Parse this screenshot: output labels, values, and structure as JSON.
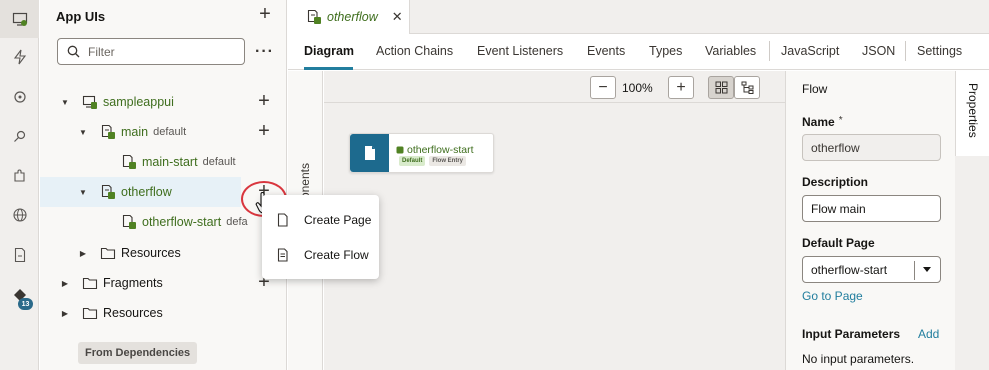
{
  "activity_bar": {
    "items": [
      {
        "icon": "app-uis-icon",
        "active": true
      },
      {
        "icon": "lightning-icon"
      },
      {
        "icon": "service-icon"
      },
      {
        "icon": "plug-icon"
      },
      {
        "icon": "puzzle-icon"
      },
      {
        "icon": "globe-icon"
      },
      {
        "icon": "document-icon"
      },
      {
        "icon": "git-icon",
        "badge": "13"
      }
    ]
  },
  "navigator": {
    "title": "App UIs",
    "filter_placeholder": "Filter",
    "tree": {
      "app": "sampleappui",
      "main": {
        "label": "main",
        "sub": "default"
      },
      "main_start": {
        "label": "main-start",
        "sub": "default"
      },
      "otherflow": {
        "label": "otherflow"
      },
      "otherflow_start": {
        "label": "otherflow-start",
        "sub": "defa"
      },
      "resources_inner": "Resources",
      "fragments": "Fragments",
      "resources": "Resources"
    },
    "from_dependencies": "From Dependencies"
  },
  "popup_menu": {
    "items": [
      "Create Page",
      "Create Flow"
    ]
  },
  "editor": {
    "tab_title": "otherflow",
    "subtabs": [
      "Diagram",
      "Action Chains",
      "Event Listeners",
      "Events",
      "Types",
      "Variables",
      "JavaScript",
      "JSON",
      "Settings"
    ],
    "active_subtab": "Diagram",
    "components_label": "Components",
    "zoom": "100%",
    "node": {
      "title": "otherflow-start",
      "tags": [
        "Default",
        "Flow Entry"
      ]
    }
  },
  "properties": {
    "rail_label": "Properties",
    "section_title": "Flow",
    "name_label": "Name",
    "required_mark": "*",
    "name_value": "otherflow",
    "description_label": "Description",
    "description_value": "Flow main",
    "default_page_label": "Default Page",
    "default_page_value": "otherflow-start",
    "go_to_page": "Go to Page",
    "input_params_label": "Input Parameters",
    "add_label": "Add",
    "no_params": "No input parameters."
  },
  "colors": {
    "accent": "#227e9e",
    "flow_green": "#3f6e1e",
    "node_blue": "#1d6a8e",
    "highlight_red": "#d9363e"
  }
}
